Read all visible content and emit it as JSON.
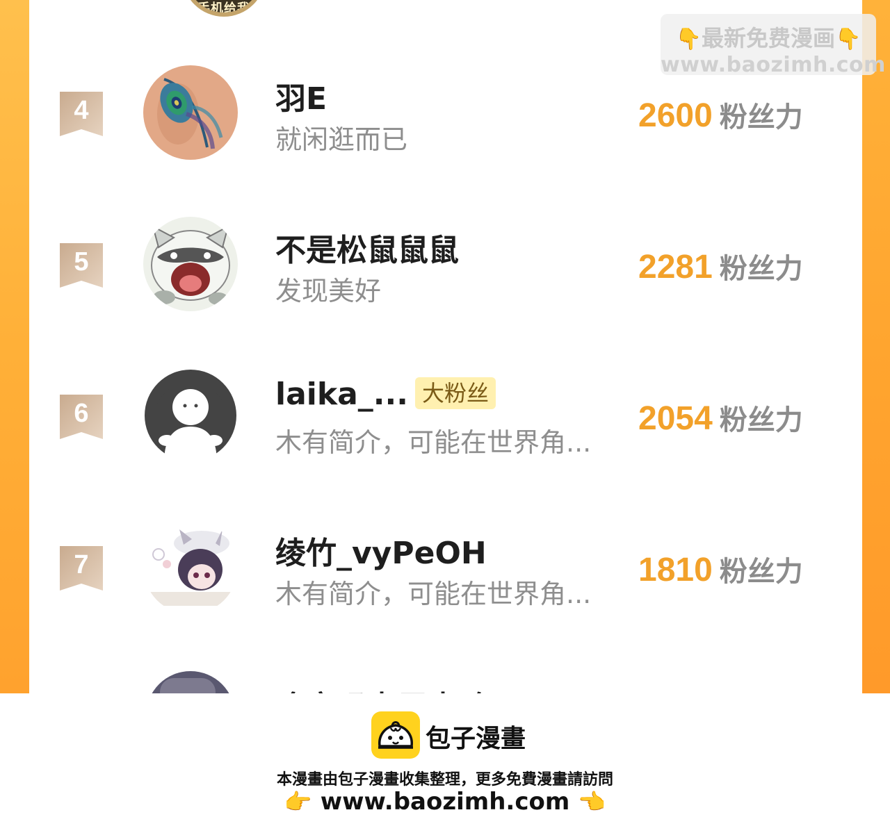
{
  "watermark": {
    "line1": "最新免费漫画",
    "line2": "www.baozimh.com",
    "left_hand": "👇",
    "right_hand": "👇"
  },
  "top_avatar_text": "手机给我",
  "score_unit": "粉丝力",
  "rows": [
    {
      "rank": "4",
      "name": "羽E",
      "badge": "",
      "bio": "就闲逛而已",
      "score": "2600",
      "avatar": "peacock-feather-avatar"
    },
    {
      "rank": "5",
      "name": "不是松鼠鼠鼠",
      "badge": "",
      "bio": "发现美好",
      "score": "2281",
      "avatar": "raccoon-avatar"
    },
    {
      "rank": "6",
      "name": "laika_...",
      "badge": "大粉丝",
      "bio": "木有简介，可能在世界角...",
      "score": "2054",
      "avatar": "default-user-avatar"
    },
    {
      "rank": "7",
      "name": "绫竹_vyPeOH",
      "badge": "",
      "bio": "木有简介，可能在世界角...",
      "score": "1810",
      "avatar": "anime-cat-girl-avatar"
    }
  ],
  "partial_row": {
    "name": "咚宝玛卡巴卡哈"
  },
  "footer": {
    "brand": "包子漫畫",
    "notice": "本漫畫由包子漫畫收集整理，更多免費漫畫請訪問",
    "url": "www.baozimh.com",
    "left_hand": "👉",
    "right_hand": "👈"
  },
  "colors": {
    "accent_orange": "#f2a12a",
    "rank_ribbon": "#d2b49a",
    "badge_bg": "#fff0b0",
    "brand_yellow": "#ffd21e"
  }
}
